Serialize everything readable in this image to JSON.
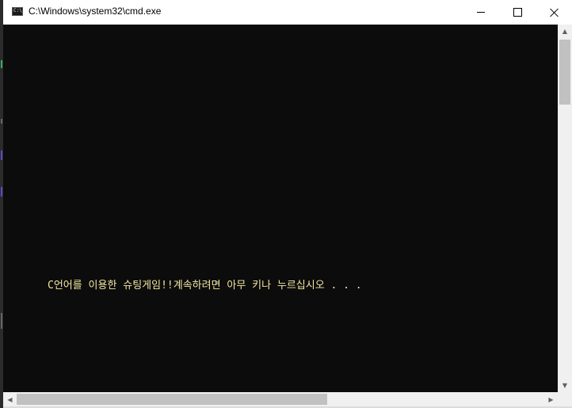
{
  "window": {
    "title": "C:\\Windows\\system32\\cmd.exe",
    "app_icon_text": "C:\\_"
  },
  "controls": {
    "minimize": "minimize",
    "maximize": "maximize",
    "close": "close"
  },
  "console": {
    "background_color": "#0c0c0c",
    "text_color": "#f2e6a0",
    "output_line": "C언어를 이용한 슈팅게임!!계속하려면 아무 키나 누르십시오 . . ."
  },
  "scrollbars": {
    "vertical_position": 0.0,
    "horizontal_position": 0.0
  }
}
